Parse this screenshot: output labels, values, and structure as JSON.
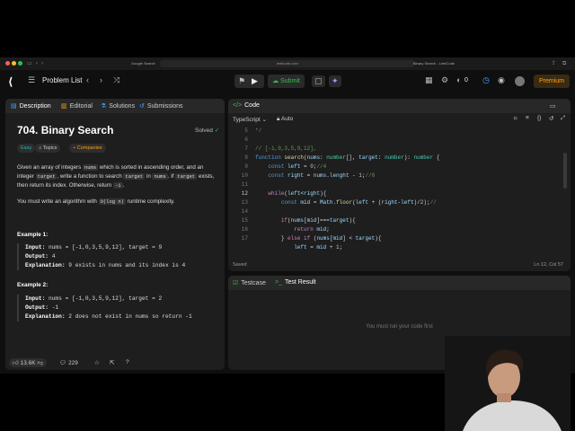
{
  "browser": {
    "url": "leetcode.com",
    "tab_left": "Google Search",
    "tab_right": "Binary Search - LeetCode"
  },
  "nav": {
    "problem_list": "Problem List",
    "submit": "Submit",
    "streak": "0",
    "premium": "Premium"
  },
  "desc": {
    "tabs": [
      "Description",
      "Editorial",
      "Solutions",
      "Submissions"
    ],
    "title": "704. Binary Search",
    "solved": "Solved",
    "chips": [
      "Easy",
      "Topics",
      "Companies"
    ],
    "p1_a": "Given an array of integers ",
    "p1_b": "nums",
    "p1_c": " which is sorted in ascending order, and an integer ",
    "p1_d": "target",
    "p1_e": ", write a function to search ",
    "p1_f": "target",
    "p1_g": " in ",
    "p1_h": "nums",
    "p1_i": ". If ",
    "p1_j": "target",
    "p1_k": " exists, then return its index. Otherwise, return ",
    "p1_l": "-1",
    "p1_m": ".",
    "p2_a": "You must write an algorithm with ",
    "p2_b": "O(log n)",
    "p2_c": " runtime complexity.",
    "ex1_label": "Example 1:",
    "ex1_input_k": "Input:",
    "ex1_input_v": "nums = [-1,0,3,5,9,12], target = 9",
    "ex1_output_k": "Output:",
    "ex1_output_v": "4",
    "ex1_expl_k": "Explanation:",
    "ex1_expl_v": "9 exists in nums and its index is 4",
    "ex2_label": "Example 2:",
    "ex2_input_k": "Input:",
    "ex2_input_v": "nums = [-1,0,3,5,9,12], target = 2",
    "ex2_output_k": "Output:",
    "ex2_output_v": "-1",
    "ex2_expl_k": "Explanation:",
    "ex2_expl_v": "2 does not exist in nums so return -1",
    "likes": "13.6K",
    "comments": "229"
  },
  "code": {
    "title": "Code",
    "language": "TypeScript",
    "auto": "Auto",
    "saved": "Saved",
    "cursor": "Ln 12, Col 57",
    "line_numbers": [
      "5",
      "6",
      "7",
      "8",
      "9",
      "10",
      "11",
      "12",
      "13",
      "14",
      "15",
      "16",
      "17"
    ]
  },
  "test": {
    "tab_testcase": "Testcase",
    "tab_result": "Test Result",
    "message": "You must run your code first"
  }
}
